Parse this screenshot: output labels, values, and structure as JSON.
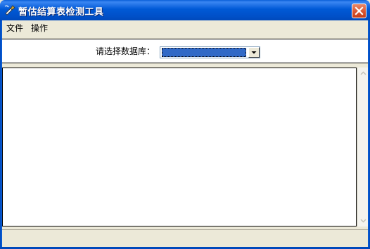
{
  "window": {
    "title": "暂估结算表检测工具",
    "colors": {
      "titlebar": "#0058d8",
      "close": "#d9512c",
      "selection": "#3169c6"
    }
  },
  "menu": {
    "items": [
      {
        "label": "文件"
      },
      {
        "label": "操作"
      }
    ]
  },
  "database": {
    "label": "请选择数据库：",
    "selected": ""
  },
  "output": {
    "text": ""
  },
  "status": {
    "text": ""
  },
  "icons": {
    "app": "tool-icon",
    "close": "close-icon",
    "dropdown": "chevron-down-icon",
    "scroll_up": "arrow-up-icon",
    "scroll_down": "arrow-down-icon"
  }
}
